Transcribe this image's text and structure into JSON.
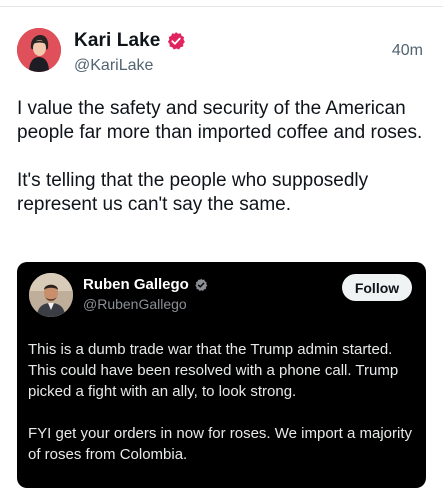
{
  "post": {
    "author": {
      "display_name": "Kari Lake",
      "handle": "@KariLake",
      "verified_badge_color": "#e0245e",
      "avatar_icon": "profile-photo"
    },
    "time": "40m",
    "paragraphs": [
      "I value the safety and security of the American people far more than imported coffee and roses.",
      "It's telling that the people who supposedly represent us can't say the same."
    ]
  },
  "quote": {
    "author": {
      "display_name": "Ruben Gallego",
      "handle": "@RubenGallego",
      "verified_badge_color": "#8b8f93",
      "avatar_icon": "profile-photo"
    },
    "follow_label": "Follow",
    "paragraphs": [
      "This is a dumb trade war that the Trump admin started.  This could have been resolved with a phone call. Trump picked a fight with an ally, to look strong.",
      "FYI get your orders in now for roses.  We import a majority of roses from Colombia."
    ]
  },
  "colors": {
    "text_primary": "#0f1419",
    "text_secondary": "#536471",
    "quote_background": "#000000"
  }
}
